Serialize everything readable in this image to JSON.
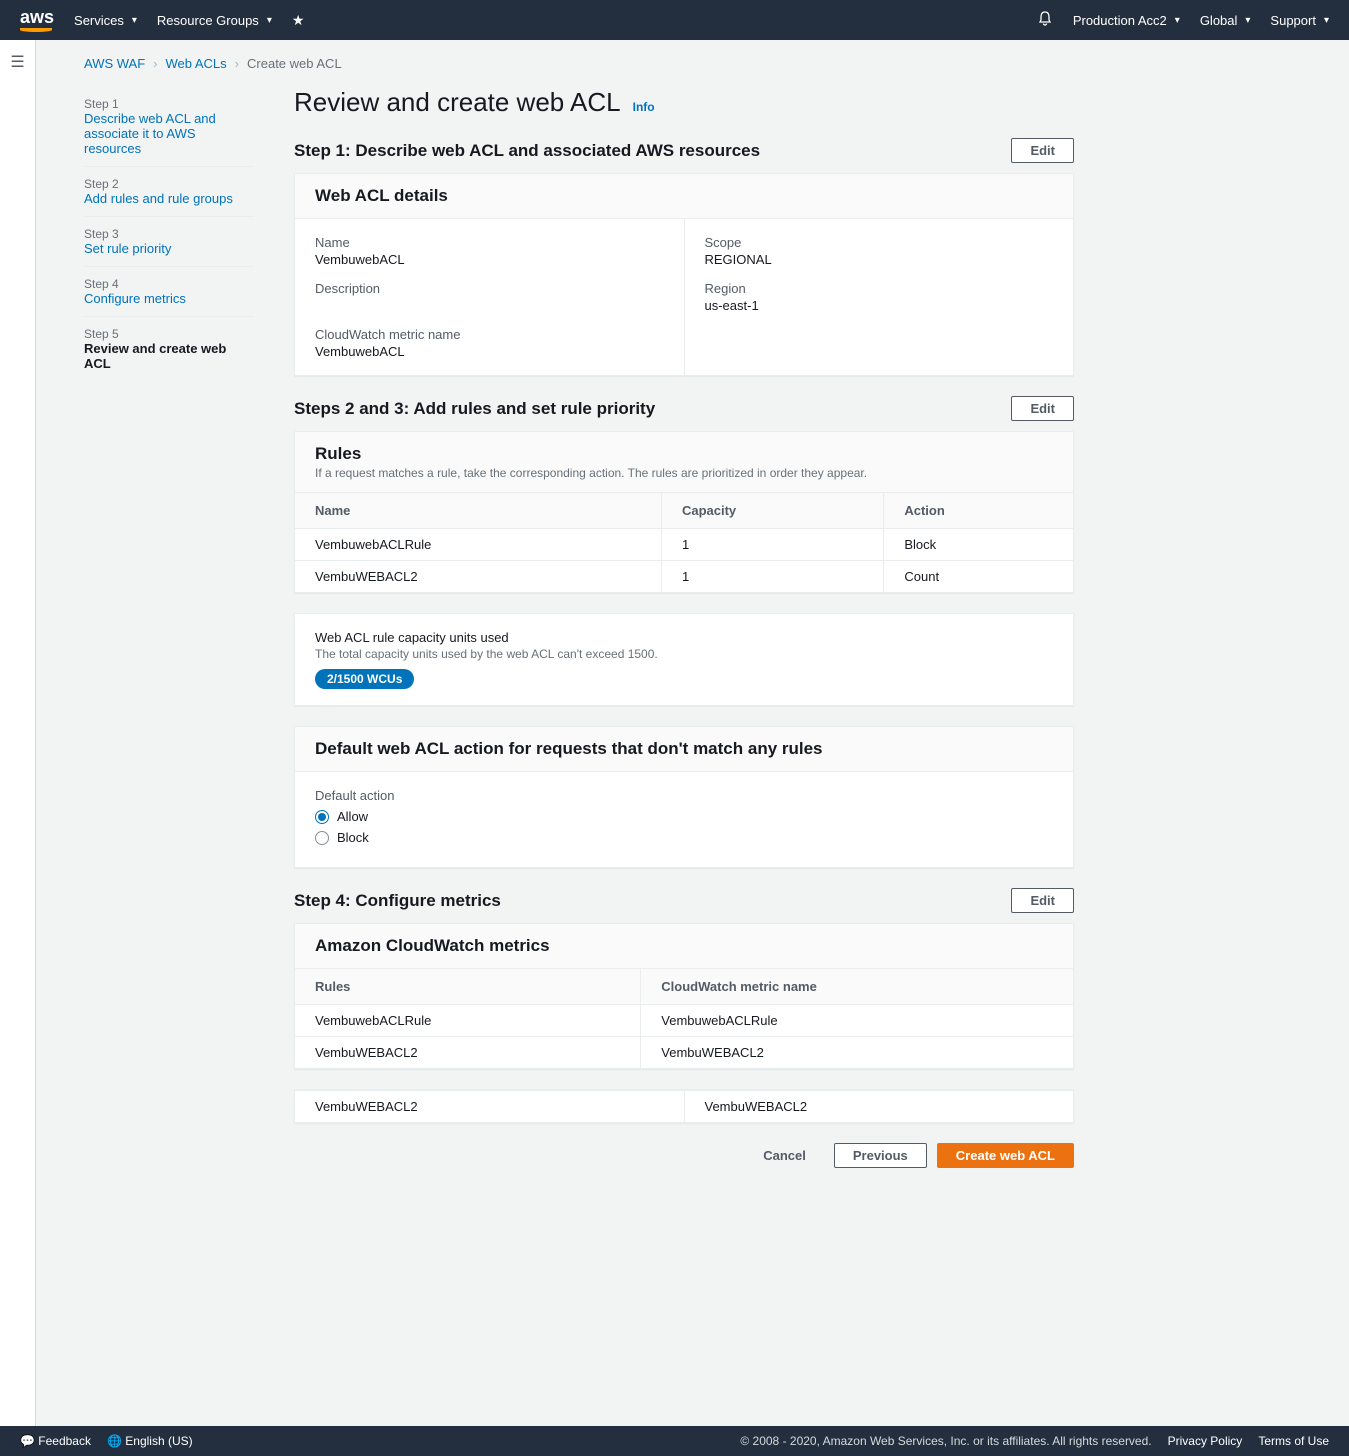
{
  "topnav": {
    "services": "Services",
    "resource_groups": "Resource Groups",
    "account": "Production Acc2",
    "region": "Global",
    "support": "Support"
  },
  "breadcrumb": {
    "waf": "AWS WAF",
    "acls": "Web ACLs",
    "current": "Create web ACL"
  },
  "wizard_steps": [
    {
      "label": "Step 1",
      "title": "Describe web ACL and associate it to AWS resources"
    },
    {
      "label": "Step 2",
      "title": "Add rules and rule groups"
    },
    {
      "label": "Step 3",
      "title": "Set rule priority"
    },
    {
      "label": "Step 4",
      "title": "Configure metrics"
    },
    {
      "label": "Step 5",
      "title": "Review and create web ACL"
    }
  ],
  "page_title": "Review and create web ACL",
  "info": "Info",
  "step1": {
    "heading": "Step 1: Describe web ACL and associated AWS resources",
    "edit": "Edit",
    "panel_title": "Web ACL details",
    "name_label": "Name",
    "name_value": "VembuwebACL",
    "description_label": "Description",
    "metric_label": "CloudWatch metric name",
    "metric_value": "VembuwebACL",
    "scope_label": "Scope",
    "scope_value": "REGIONAL",
    "region_label": "Region",
    "region_value": "us-east-1"
  },
  "step23": {
    "heading": "Steps 2 and 3: Add rules and set rule priority",
    "edit": "Edit",
    "rules_title": "Rules",
    "rules_subtext": "If a request matches a rule, take the corresponding action. The rules are prioritized in order they appear.",
    "cols": {
      "name": "Name",
      "capacity": "Capacity",
      "action": "Action"
    },
    "rows": [
      {
        "name": "VembuwebACLRule",
        "capacity": "1",
        "action": "Block"
      },
      {
        "name": "VembuWEBACL2",
        "capacity": "1",
        "action": "Count"
      }
    ],
    "wcu_title": "Web ACL rule capacity units used",
    "wcu_subtext": "The total capacity units used by the web ACL can't exceed 1500.",
    "wcu_badge": "2/1500 WCUs",
    "default_title": "Default web ACL action for requests that don't match any rules",
    "default_label": "Default action",
    "allow": "Allow",
    "block": "Block"
  },
  "step4": {
    "heading": "Step 4: Configure metrics",
    "edit": "Edit",
    "panel_title": "Amazon CloudWatch metrics",
    "cols": {
      "rules": "Rules",
      "metric": "CloudWatch metric name"
    },
    "rows": [
      {
        "rule": "VembuwebACLRule",
        "metric": "VembuwebACLRule"
      },
      {
        "rule": "VembuWEBACL2",
        "metric": "VembuWEBACL2"
      }
    ],
    "extra_row": {
      "rule": "VembuWEBACL2",
      "metric": "VembuWEBACL2"
    }
  },
  "actions": {
    "cancel": "Cancel",
    "previous": "Previous",
    "create": "Create web ACL"
  },
  "bottombar": {
    "feedback": "Feedback",
    "lang": "English (US)",
    "copyright": "© 2008 - 2020, Amazon Web Services, Inc. or its affiliates. All rights reserved.",
    "privacy": "Privacy Policy",
    "terms": "Terms of Use"
  }
}
